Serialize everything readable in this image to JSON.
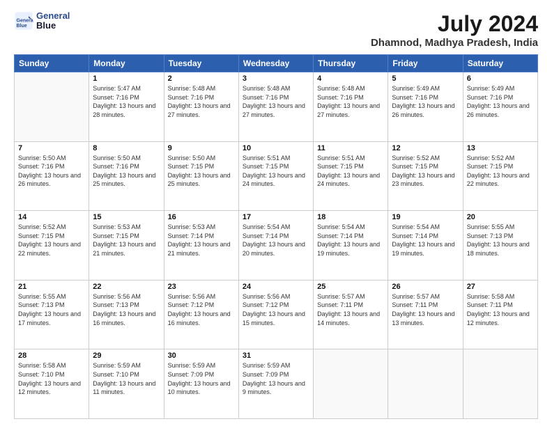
{
  "logo": {
    "line1": "General",
    "line2": "Blue"
  },
  "title": "July 2024",
  "subtitle": "Dhamnod, Madhya Pradesh, India",
  "headers": [
    "Sunday",
    "Monday",
    "Tuesday",
    "Wednesday",
    "Thursday",
    "Friday",
    "Saturday"
  ],
  "weeks": [
    [
      {
        "day": "",
        "sunrise": "",
        "sunset": "",
        "daylight": ""
      },
      {
        "day": "1",
        "sunrise": "Sunrise: 5:47 AM",
        "sunset": "Sunset: 7:16 PM",
        "daylight": "Daylight: 13 hours and 28 minutes."
      },
      {
        "day": "2",
        "sunrise": "Sunrise: 5:48 AM",
        "sunset": "Sunset: 7:16 PM",
        "daylight": "Daylight: 13 hours and 27 minutes."
      },
      {
        "day": "3",
        "sunrise": "Sunrise: 5:48 AM",
        "sunset": "Sunset: 7:16 PM",
        "daylight": "Daylight: 13 hours and 27 minutes."
      },
      {
        "day": "4",
        "sunrise": "Sunrise: 5:48 AM",
        "sunset": "Sunset: 7:16 PM",
        "daylight": "Daylight: 13 hours and 27 minutes."
      },
      {
        "day": "5",
        "sunrise": "Sunrise: 5:49 AM",
        "sunset": "Sunset: 7:16 PM",
        "daylight": "Daylight: 13 hours and 26 minutes."
      },
      {
        "day": "6",
        "sunrise": "Sunrise: 5:49 AM",
        "sunset": "Sunset: 7:16 PM",
        "daylight": "Daylight: 13 hours and 26 minutes."
      }
    ],
    [
      {
        "day": "7",
        "sunrise": "Sunrise: 5:50 AM",
        "sunset": "Sunset: 7:16 PM",
        "daylight": "Daylight: 13 hours and 26 minutes."
      },
      {
        "day": "8",
        "sunrise": "Sunrise: 5:50 AM",
        "sunset": "Sunset: 7:16 PM",
        "daylight": "Daylight: 13 hours and 25 minutes."
      },
      {
        "day": "9",
        "sunrise": "Sunrise: 5:50 AM",
        "sunset": "Sunset: 7:15 PM",
        "daylight": "Daylight: 13 hours and 25 minutes."
      },
      {
        "day": "10",
        "sunrise": "Sunrise: 5:51 AM",
        "sunset": "Sunset: 7:15 PM",
        "daylight": "Daylight: 13 hours and 24 minutes."
      },
      {
        "day": "11",
        "sunrise": "Sunrise: 5:51 AM",
        "sunset": "Sunset: 7:15 PM",
        "daylight": "Daylight: 13 hours and 24 minutes."
      },
      {
        "day": "12",
        "sunrise": "Sunrise: 5:52 AM",
        "sunset": "Sunset: 7:15 PM",
        "daylight": "Daylight: 13 hours and 23 minutes."
      },
      {
        "day": "13",
        "sunrise": "Sunrise: 5:52 AM",
        "sunset": "Sunset: 7:15 PM",
        "daylight": "Daylight: 13 hours and 22 minutes."
      }
    ],
    [
      {
        "day": "14",
        "sunrise": "Sunrise: 5:52 AM",
        "sunset": "Sunset: 7:15 PM",
        "daylight": "Daylight: 13 hours and 22 minutes."
      },
      {
        "day": "15",
        "sunrise": "Sunrise: 5:53 AM",
        "sunset": "Sunset: 7:15 PM",
        "daylight": "Daylight: 13 hours and 21 minutes."
      },
      {
        "day": "16",
        "sunrise": "Sunrise: 5:53 AM",
        "sunset": "Sunset: 7:14 PM",
        "daylight": "Daylight: 13 hours and 21 minutes."
      },
      {
        "day": "17",
        "sunrise": "Sunrise: 5:54 AM",
        "sunset": "Sunset: 7:14 PM",
        "daylight": "Daylight: 13 hours and 20 minutes."
      },
      {
        "day": "18",
        "sunrise": "Sunrise: 5:54 AM",
        "sunset": "Sunset: 7:14 PM",
        "daylight": "Daylight: 13 hours and 19 minutes."
      },
      {
        "day": "19",
        "sunrise": "Sunrise: 5:54 AM",
        "sunset": "Sunset: 7:14 PM",
        "daylight": "Daylight: 13 hours and 19 minutes."
      },
      {
        "day": "20",
        "sunrise": "Sunrise: 5:55 AM",
        "sunset": "Sunset: 7:13 PM",
        "daylight": "Daylight: 13 hours and 18 minutes."
      }
    ],
    [
      {
        "day": "21",
        "sunrise": "Sunrise: 5:55 AM",
        "sunset": "Sunset: 7:13 PM",
        "daylight": "Daylight: 13 hours and 17 minutes."
      },
      {
        "day": "22",
        "sunrise": "Sunrise: 5:56 AM",
        "sunset": "Sunset: 7:13 PM",
        "daylight": "Daylight: 13 hours and 16 minutes."
      },
      {
        "day": "23",
        "sunrise": "Sunrise: 5:56 AM",
        "sunset": "Sunset: 7:12 PM",
        "daylight": "Daylight: 13 hours and 16 minutes."
      },
      {
        "day": "24",
        "sunrise": "Sunrise: 5:56 AM",
        "sunset": "Sunset: 7:12 PM",
        "daylight": "Daylight: 13 hours and 15 minutes."
      },
      {
        "day": "25",
        "sunrise": "Sunrise: 5:57 AM",
        "sunset": "Sunset: 7:11 PM",
        "daylight": "Daylight: 13 hours and 14 minutes."
      },
      {
        "day": "26",
        "sunrise": "Sunrise: 5:57 AM",
        "sunset": "Sunset: 7:11 PM",
        "daylight": "Daylight: 13 hours and 13 minutes."
      },
      {
        "day": "27",
        "sunrise": "Sunrise: 5:58 AM",
        "sunset": "Sunset: 7:11 PM",
        "daylight": "Daylight: 13 hours and 12 minutes."
      }
    ],
    [
      {
        "day": "28",
        "sunrise": "Sunrise: 5:58 AM",
        "sunset": "Sunset: 7:10 PM",
        "daylight": "Daylight: 13 hours and 12 minutes."
      },
      {
        "day": "29",
        "sunrise": "Sunrise: 5:59 AM",
        "sunset": "Sunset: 7:10 PM",
        "daylight": "Daylight: 13 hours and 11 minutes."
      },
      {
        "day": "30",
        "sunrise": "Sunrise: 5:59 AM",
        "sunset": "Sunset: 7:09 PM",
        "daylight": "Daylight: 13 hours and 10 minutes."
      },
      {
        "day": "31",
        "sunrise": "Sunrise: 5:59 AM",
        "sunset": "Sunset: 7:09 PM",
        "daylight": "Daylight: 13 hours and 9 minutes."
      },
      {
        "day": "",
        "sunrise": "",
        "sunset": "",
        "daylight": ""
      },
      {
        "day": "",
        "sunrise": "",
        "sunset": "",
        "daylight": ""
      },
      {
        "day": "",
        "sunrise": "",
        "sunset": "",
        "daylight": ""
      }
    ]
  ]
}
